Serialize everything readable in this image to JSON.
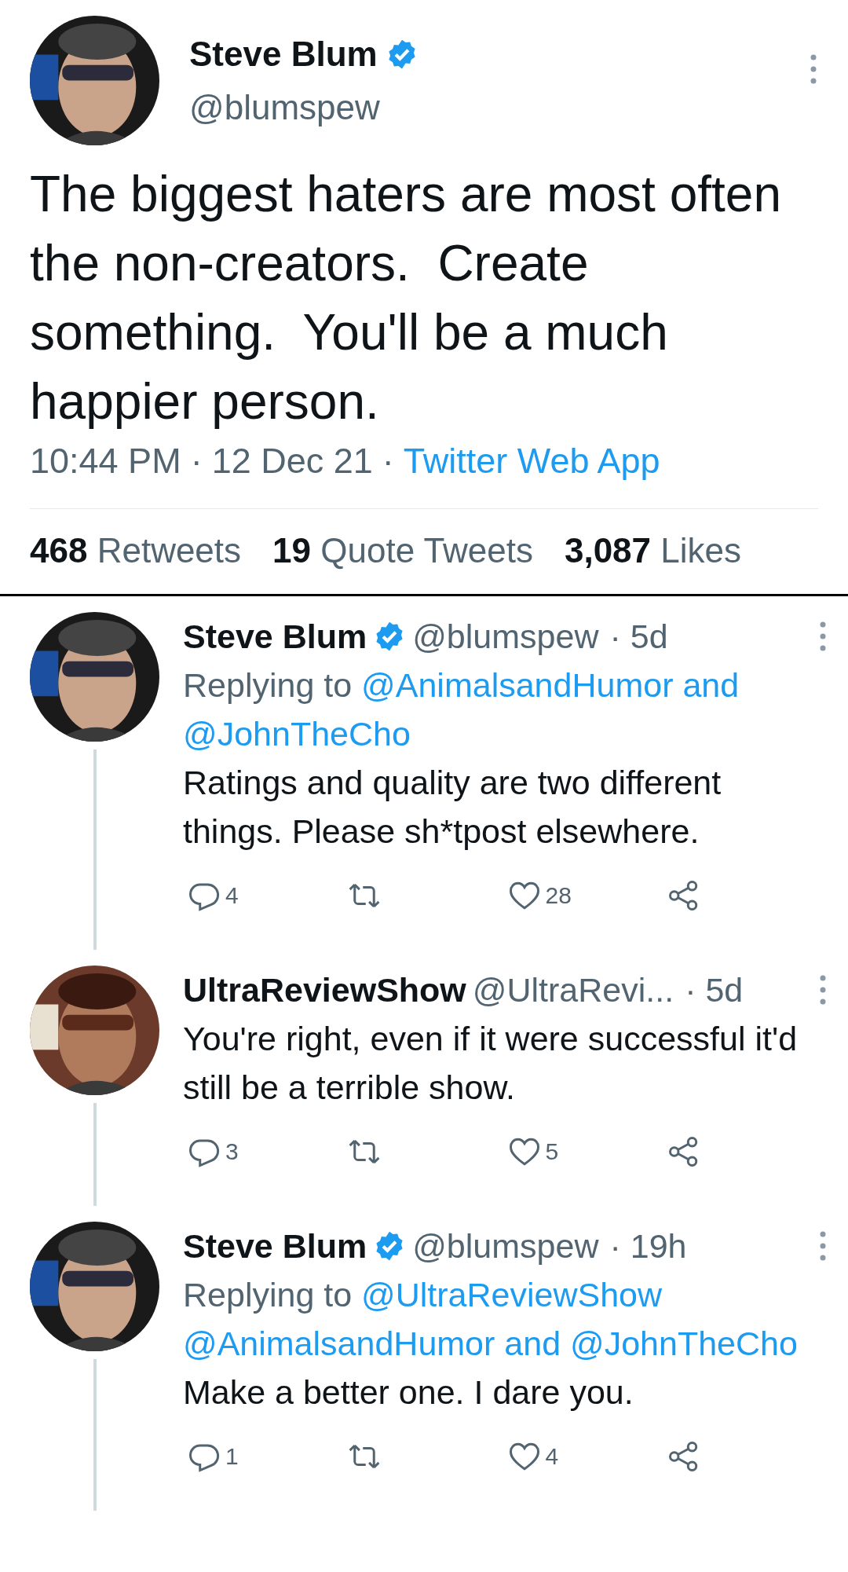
{
  "tweet": {
    "author": {
      "name": "Steve Blum",
      "verified": true,
      "handle": "@blumspew"
    },
    "text": "The biggest haters are most often the non-creators.  Create something.  You'll be a much happier person.",
    "meta": [
      {
        "kind": "time",
        "text": "10:44 PM"
      },
      {
        "kind": "separator",
        "text": "·"
      },
      {
        "kind": "date",
        "text": "12 Dec 21"
      },
      {
        "kind": "separator",
        "text": "·"
      },
      {
        "kind": "source",
        "text": "Twitter Web App"
      }
    ],
    "stats": [
      {
        "count": "468",
        "label": "Retweets"
      },
      {
        "count": "19",
        "label": "Quote Tweets"
      },
      {
        "count": "3,087",
        "label": "Likes"
      }
    ]
  },
  "replies": [
    {
      "name": "Steve Blum",
      "verified": true,
      "handle": "@blumspew",
      "age": "· 5d",
      "replying_label": "Replying to",
      "mentions": [
        "@AnimalsandHumor and",
        "@JohnTheCho"
      ],
      "text": "Ratings and quality are two different things. Please sh*tpost elsewhere.",
      "actions": [
        {
          "kind": "reply",
          "count": "4"
        },
        {
          "kind": "retweet"
        },
        {
          "kind": "like",
          "count": "28"
        },
        {
          "kind": "share"
        }
      ]
    },
    {
      "name": "UltraReviewShow",
      "verified": false,
      "handle": "@UltraRevi...",
      "age": "· 5d",
      "text": "You're right, even if it were successful it'd still be a terrible show.",
      "actions": [
        {
          "kind": "reply",
          "count": "3"
        },
        {
          "kind": "retweet"
        },
        {
          "kind": "like",
          "count": "5"
        },
        {
          "kind": "share"
        }
      ]
    },
    {
      "name": "Steve Blum",
      "verified": true,
      "handle": "@blumspew",
      "age": "· 19h",
      "replying_label": "Replying to",
      "mentions": [
        "@UltraReviewShow",
        "@AnimalsandHumor and",
        "@JohnTheCho"
      ],
      "text": "Make a better one. I dare you.",
      "actions": [
        {
          "kind": "reply",
          "count": "1"
        },
        {
          "kind": "retweet"
        },
        {
          "kind": "like",
          "count": "4"
        },
        {
          "kind": "share"
        }
      ]
    }
  ]
}
